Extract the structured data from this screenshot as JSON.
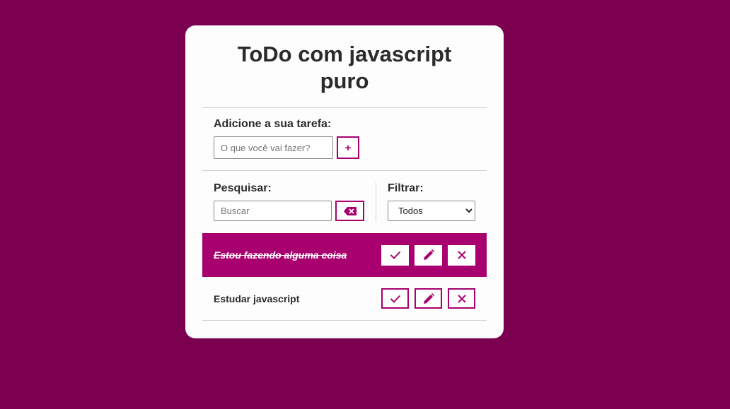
{
  "title": "ToDo com javascript puro",
  "add": {
    "label": "Adicione a sua tarefa:",
    "placeholder": "O que você vai fazer?",
    "button_label": "+"
  },
  "search": {
    "label": "Pesquisar:",
    "placeholder": "Buscar",
    "clear_icon": "backspace-icon"
  },
  "filter": {
    "label": "Filtrar:",
    "selected": "Todos"
  },
  "todos": [
    {
      "text": "Estou fazendo alguma coisa",
      "done": true
    },
    {
      "text": "Estudar javascript",
      "done": false
    }
  ],
  "colors": {
    "background": "#7a004f",
    "accent": "#a8006e",
    "card": "#fdfdfd"
  },
  "icons": {
    "finish": "check-icon",
    "edit": "pen-icon",
    "remove": "x-icon"
  }
}
